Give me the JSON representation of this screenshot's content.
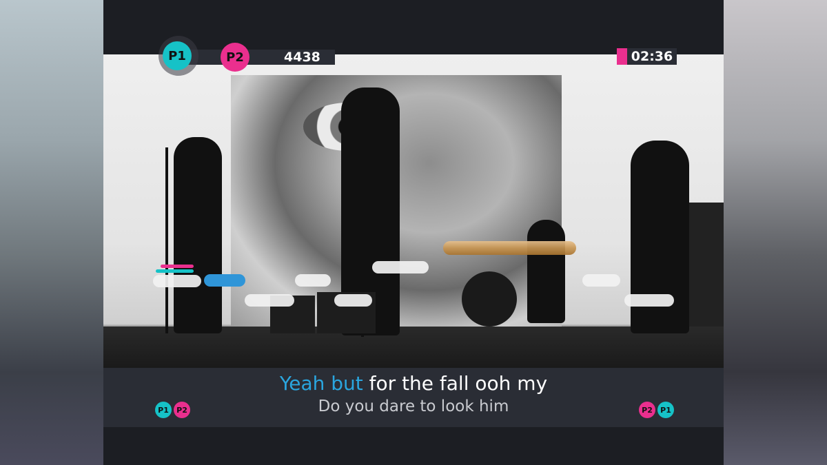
{
  "players": {
    "p1": {
      "label": "P1",
      "color": "#16c2c7"
    },
    "p2": {
      "label": "P2",
      "color": "#ea2f8e"
    }
  },
  "score": "4438",
  "timer": "02:36",
  "lyrics": {
    "current_sung": "Yeah but",
    "current_rest": " for the fall ooh my",
    "next": "Do you dare to look him"
  },
  "colors": {
    "sung_highlight": "#2aa6df",
    "active_note": "#2f95d8",
    "long_note": "#c79552",
    "panel": "#2a2d35"
  },
  "lyric_player_indicators": {
    "left": [
      "P1",
      "P2"
    ],
    "right": [
      "P2",
      "P1"
    ]
  }
}
